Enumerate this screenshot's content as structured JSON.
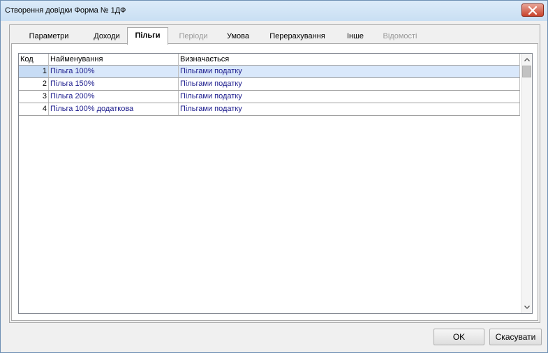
{
  "window": {
    "title": "Створення довідки Форма № 1ДФ"
  },
  "tabs": [
    {
      "label": "Параметри",
      "state": "normal"
    },
    {
      "label": "Доходи",
      "state": "normal"
    },
    {
      "label": "Пільги",
      "state": "active"
    },
    {
      "label": "Періоди",
      "state": "disabled"
    },
    {
      "label": "Умова",
      "state": "normal"
    },
    {
      "label": "Перерахування",
      "state": "normal"
    },
    {
      "label": "Інше",
      "state": "normal"
    },
    {
      "label": "Відомості",
      "state": "disabled"
    }
  ],
  "grid": {
    "columns": [
      "Код",
      "Найменування",
      "Визначається"
    ],
    "rows": [
      {
        "code": "1",
        "name": "Пільга 100%",
        "determined": "Пільгами податку",
        "selected": true
      },
      {
        "code": "2",
        "name": "Пільга 150%",
        "determined": "Пільгами податку",
        "selected": false
      },
      {
        "code": "3",
        "name": "Пільга 200%",
        "determined": "Пільгами податку",
        "selected": false
      },
      {
        "code": "4",
        "name": "Пільга 100% додаткова",
        "determined": "Пільгами податку",
        "selected": false
      }
    ]
  },
  "buttons": {
    "ok": "OK",
    "cancel": "Скасувати"
  },
  "icons": {
    "close": "close-icon",
    "scroll_up": "chevron-up-icon",
    "scroll_down": "chevron-down-icon"
  },
  "colors": {
    "selection": "#d9e8fb",
    "link_text": "#1a1a8c",
    "close_button": "#c8432c"
  }
}
